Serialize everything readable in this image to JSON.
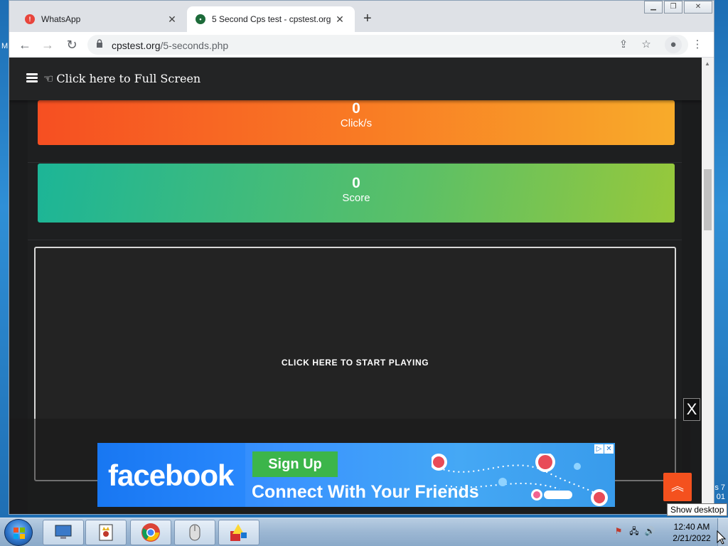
{
  "browser": {
    "tabs": [
      {
        "title": "WhatsApp",
        "close": "✕"
      },
      {
        "title": "5 Second Cps test - cpstest.org",
        "close": "✕"
      }
    ],
    "new_tab": "+",
    "address": {
      "domain": "cpstest.org",
      "path": "/5-seconds.php"
    },
    "icons": [
      "back-icon",
      "forward-icon",
      "reload-icon",
      "lock-icon",
      "share-icon",
      "star-icon",
      "profile-icon",
      "menu-icon"
    ]
  },
  "page": {
    "header": {
      "fullscreen_label": "Click here to Full Screen"
    },
    "cps": {
      "value": "0",
      "label": "Click/s"
    },
    "score": {
      "value": "0",
      "label": "Score"
    },
    "play_area": {
      "prompt": "CLICK HERE TO START PLAYING"
    },
    "scroll_top_icon": "double-chevron-up-icon"
  },
  "ad": {
    "close_label": "X",
    "brand": "facebook",
    "cta": "Sign Up",
    "tagline": "Connect With Your Friends",
    "colors": {
      "brand": "#1877f2",
      "cta": "#3cb54a"
    }
  },
  "desktop": {
    "left_edge_text": "M",
    "right_edge_text": "s 7\n01"
  },
  "taskbar": {
    "apps": [
      "computer-app",
      "solitaire-app",
      "chrome-app",
      "mouse-app",
      "paint-app"
    ],
    "clock": {
      "time": "12:40 AM",
      "date": "2/21/2022"
    },
    "show_desktop_tooltip": "Show desktop"
  },
  "colors": {
    "cps_gradient_start": "#f64f22",
    "cps_gradient_end": "#f8ab2a",
    "score_gradient_start": "#1cb597",
    "score_gradient_end": "#97c83b",
    "scroll_top": "#f4511e"
  }
}
